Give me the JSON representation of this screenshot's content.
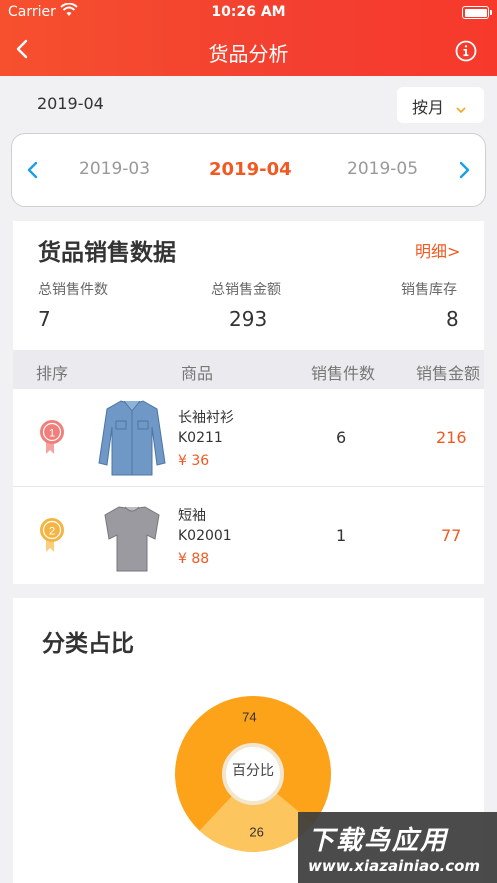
{
  "status_bar": {
    "carrier": "Carrier",
    "time": "10:26 AM"
  },
  "nav": {
    "title": "货品分析",
    "back_icon": "chevron-left-icon",
    "info_icon": "info-circle-icon"
  },
  "date_row": {
    "current_date": "2019-04",
    "period_selector": "按月"
  },
  "month_switcher": {
    "prev": "2019-03",
    "current": "2019-04",
    "next": "2019-05"
  },
  "sales": {
    "title": "货品销售数据",
    "detail_link": "明细>",
    "stats": [
      {
        "label": "总销售件数",
        "value": "7"
      },
      {
        "label": "总销售金额",
        "value": "293"
      },
      {
        "label": "销售库存",
        "value": "8"
      }
    ],
    "columns": [
      "排序",
      "商品",
      "销售件数",
      "销售金额"
    ],
    "rows": [
      {
        "rank": "1",
        "name": "长袖衬衫",
        "code": "K0211",
        "price": "¥ 36",
        "qty": "6",
        "amount": "216"
      },
      {
        "rank": "2",
        "name": "短袖",
        "code": "K02001",
        "price": "¥ 88",
        "qty": "1",
        "amount": "77"
      }
    ]
  },
  "category": {
    "title": "分类占比",
    "center_label": "百分比",
    "slices": [
      {
        "value": 74,
        "label": "74",
        "color": "#fca31a"
      },
      {
        "value": 26,
        "label": "26",
        "color": "#fdc55e"
      }
    ]
  },
  "colors": {
    "accent": "#f05a22",
    "nav_bg": "#f44a2f",
    "rank1": "#f07f7c",
    "rank2": "#f5b545"
  },
  "watermark": {
    "line1": "下载鸟应用",
    "line2": "www.xiazainiao.com"
  }
}
